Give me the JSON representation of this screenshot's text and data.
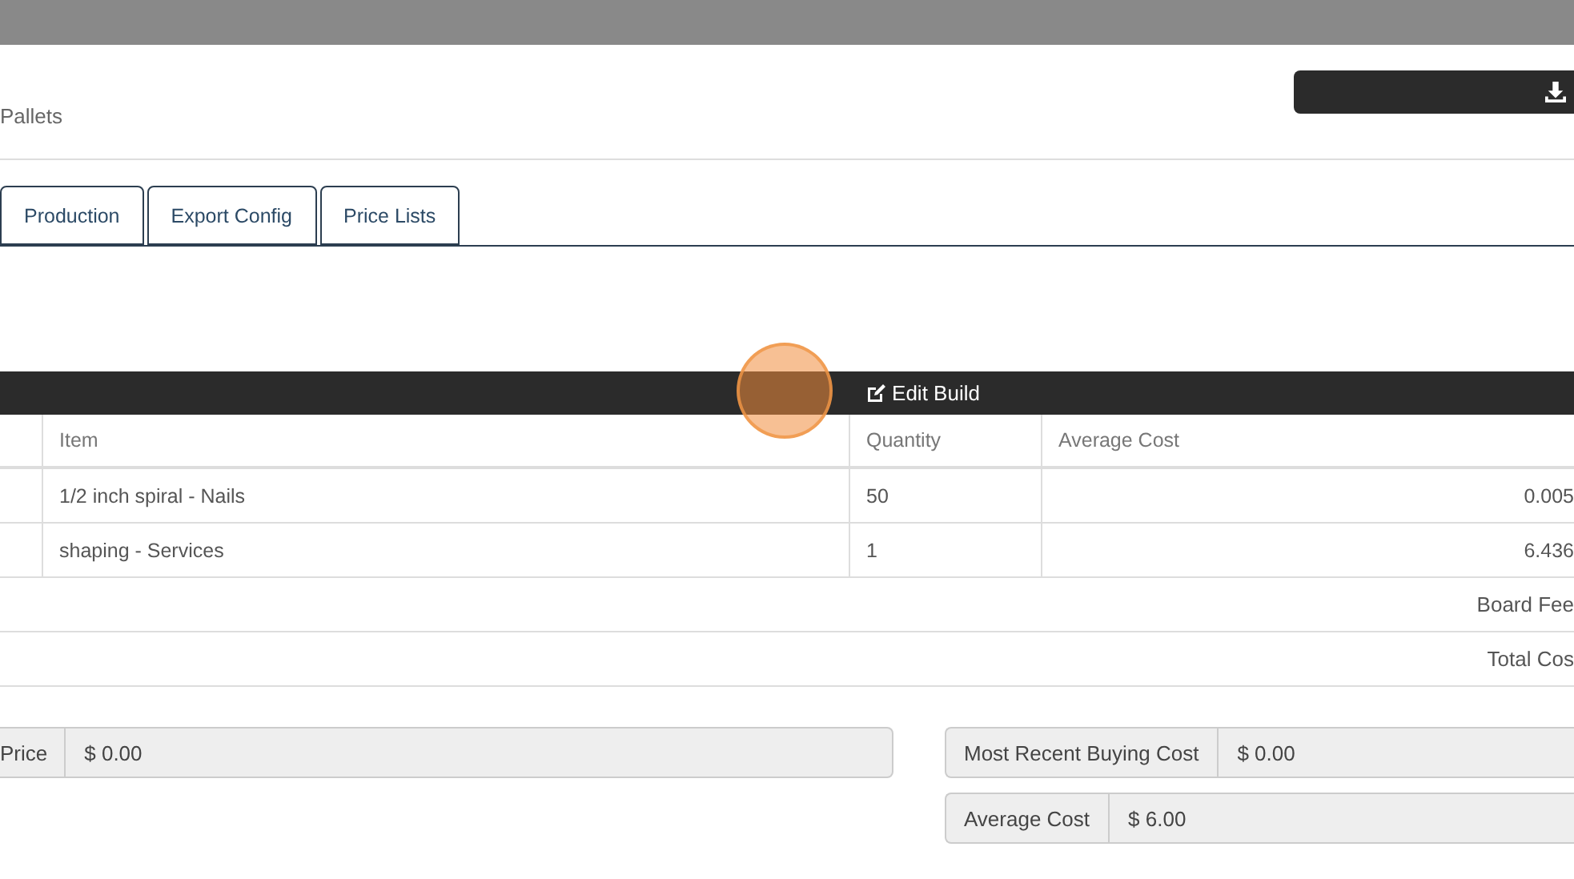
{
  "header": {
    "subtitle": "Pallets"
  },
  "tabs": [
    {
      "label": "Production",
      "selected": false
    },
    {
      "label": "Export Config",
      "selected": false
    },
    {
      "label": "Price Lists",
      "selected": false
    }
  ],
  "build_bar": {
    "label": "Edit Build"
  },
  "table": {
    "columns": [
      "Item",
      "Quantity",
      "Average Cost"
    ],
    "rows": [
      {
        "item": "1/2 inch spiral - Nails",
        "quantity": "50",
        "cost": "0.005"
      },
      {
        "item": "shaping - Services",
        "quantity": "1",
        "cost": "6.436"
      }
    ],
    "summary": [
      "Board Fee",
      "Total Cos"
    ]
  },
  "left_fields": [
    {
      "label": "Price",
      "value": "$ 0.00"
    }
  ],
  "right_fields": [
    {
      "label": "Most Recent Buying Cost",
      "value": "$ 0.00"
    },
    {
      "label": "Average Cost",
      "value": "$ 6.00"
    }
  ]
}
